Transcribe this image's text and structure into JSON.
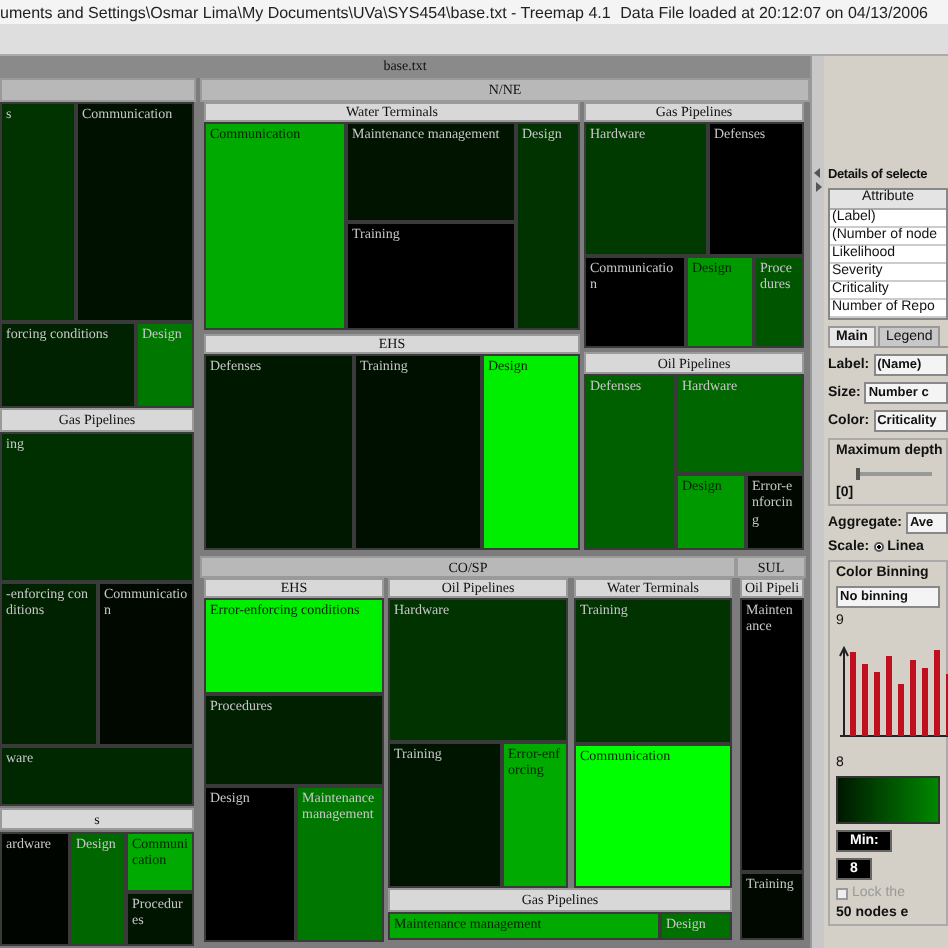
{
  "window": {
    "title": "uments and Settings\\Osmar Lima\\My Documents\\UVa\\SYS454\\base.txt - Treemap 4.1",
    "status": "Data File loaded at 20:12:07 on 04/13/2006"
  },
  "treemap": {
    "root_label": "base.txt",
    "groups": [
      {
        "subgroups": [
          {
            "cells": [
              {
                "label": "s",
                "color": "#003300"
              },
              {
                "label": "Communication",
                "color": "#001100"
              },
              {
                "label": "forcing conditions",
                "color": "#002200"
              },
              {
                "label": "Design",
                "color": "#007700"
              }
            ]
          },
          {
            "label": "Gas Pipelines",
            "cells": [
              {
                "label": "ing",
                "color": "#003000"
              },
              {
                "label": "-enforcing conditions",
                "color": "#002200"
              },
              {
                "label": "Communication",
                "color": "#000800"
              },
              {
                "label": "ware",
                "color": "#002800"
              }
            ]
          },
          {
            "label": "s",
            "cells": [
              {
                "label": "ardware",
                "color": "#000500"
              },
              {
                "label": "Design",
                "color": "#006600"
              },
              {
                "label": "Communication",
                "color": "#00aa00"
              },
              {
                "label": "Procedures",
                "color": "#001500"
              }
            ]
          }
        ]
      },
      {
        "label": "N/NE",
        "subgroups": [
          {
            "label": "Water Terminals",
            "cells": [
              {
                "label": "Communication",
                "color": "#00aa00"
              },
              {
                "label": "Maintenance management",
                "color": "#001400"
              },
              {
                "label": "Training",
                "color": "#000000"
              },
              {
                "label": "Design",
                "color": "#003300"
              }
            ]
          },
          {
            "label": "Gas Pipelines",
            "cells": [
              {
                "label": "Hardware",
                "color": "#003a00"
              },
              {
                "label": "Defenses",
                "color": "#000000"
              },
              {
                "label": "Communication",
                "color": "#000000"
              },
              {
                "label": "Design",
                "color": "#009900"
              },
              {
                "label": "Procedures",
                "color": "#005500"
              }
            ]
          },
          {
            "label": "EHS",
            "cells": [
              {
                "label": "Defenses",
                "color": "#001800"
              },
              {
                "label": "Training",
                "color": "#001000"
              },
              {
                "label": "Design",
                "color": "#00ee00"
              }
            ]
          },
          {
            "label": "Oil Pipelines",
            "cells": [
              {
                "label": "Defenses",
                "color": "#006000"
              },
              {
                "label": "Hardware",
                "color": "#006600"
              },
              {
                "label": "Design",
                "color": "#009900"
              },
              {
                "label": "Error-enforcing",
                "color": "#000800"
              }
            ]
          }
        ]
      },
      {
        "label": "CO/SP",
        "subgroups": [
          {
            "label": "EHS",
            "cells": [
              {
                "label": "Error-enforcing conditions",
                "color": "#00ee00"
              },
              {
                "label": "Procedures",
                "color": "#002000"
              },
              {
                "label": "Design",
                "color": "#000000"
              },
              {
                "label": "Maintenance management",
                "color": "#007700"
              }
            ]
          },
          {
            "label": "Oil Pipelines",
            "cells": [
              {
                "label": "Hardware",
                "color": "#003300"
              },
              {
                "label": "Training",
                "color": "#001500"
              },
              {
                "label": "Error-enforcing",
                "color": "#00aa00"
              }
            ]
          },
          {
            "label": "Water Terminals",
            "cells": [
              {
                "label": "Training",
                "color": "#003300"
              },
              {
                "label": "Communication",
                "color": "#00ff00"
              }
            ]
          },
          {
            "label": "Gas Pipelines",
            "cells": [
              {
                "label": "Maintenance management",
                "color": "#00aa00"
              },
              {
                "label": "Design",
                "color": "#007000"
              }
            ]
          }
        ]
      },
      {
        "label": "SUL",
        "subgroups": [
          {
            "label": "Oil Pipeli",
            "cells": [
              {
                "label": "Maintenance",
                "color": "#000000"
              },
              {
                "label": "Training",
                "color": "#000800"
              }
            ]
          }
        ]
      }
    ]
  },
  "details": {
    "title": "Details of selecte",
    "column": "Attribute",
    "rows": [
      "(Label)",
      "(Number of node",
      "Likelihood",
      "Severity",
      "Criticality",
      "Number of Repo"
    ]
  },
  "tabs": [
    {
      "label": "Main",
      "selected": true
    },
    {
      "label": "Legend",
      "selected": false
    }
  ],
  "fields": [
    {
      "label": "Label:",
      "value": "(Name)"
    },
    {
      "label": "Size:",
      "value": "Number c"
    },
    {
      "label": "Color:",
      "value": "Criticality"
    }
  ],
  "depth": {
    "title": "Maximum depth",
    "level": 0,
    "reading": "[0]"
  },
  "aggregate": {
    "label": "Aggregate:",
    "value": "Ave"
  },
  "scale": {
    "label": "Scale:",
    "option": "Linea",
    "selected": true
  },
  "binning": {
    "title": "Color Binning",
    "value": "No binning",
    "max_label": "9",
    "min_label": "8"
  },
  "min": {
    "label": "Min:",
    "value": "8"
  },
  "lock": {
    "label": "Lock the",
    "checked": false,
    "disabled": true
  },
  "status": "50 nodes e"
}
